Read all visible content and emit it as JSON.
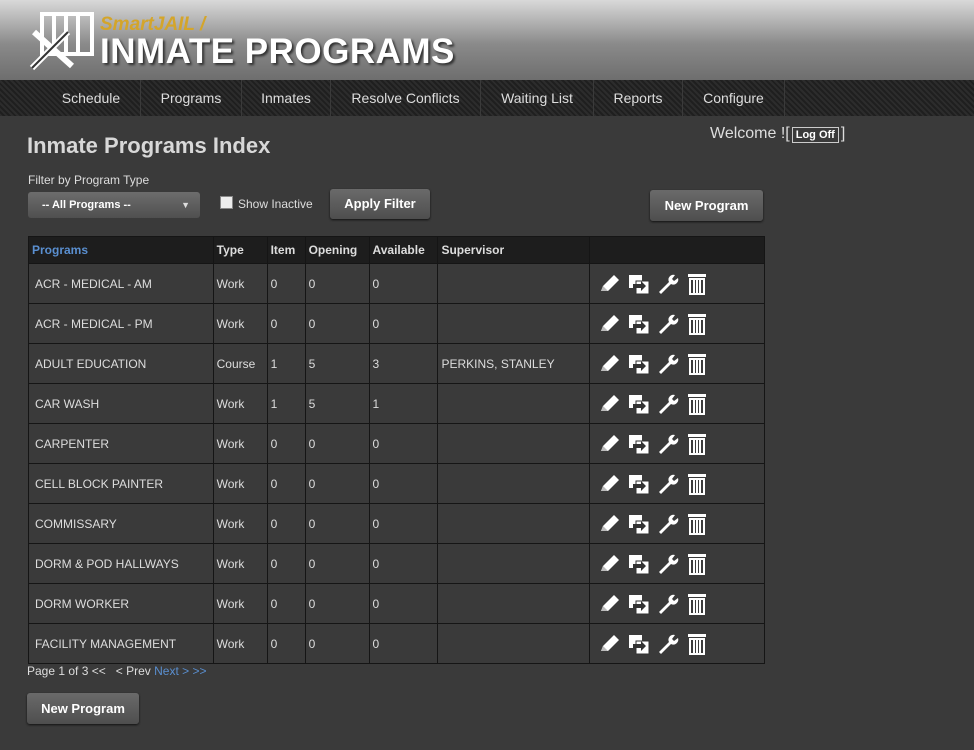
{
  "header": {
    "brand_small": "SmartJAIL /",
    "brand_big": "INMATE PROGRAMS"
  },
  "nav": [
    "Schedule",
    "Programs",
    "Inmates",
    "Resolve Conflicts",
    "Waiting List",
    "Reports",
    "Configure"
  ],
  "welcome": {
    "prefix": "Welcome ![",
    "logoff": "Log Off",
    "suffix": "]"
  },
  "page_title": "Inmate Programs Index",
  "filter": {
    "label": "Filter by Program Type",
    "selected": "-- All Programs --",
    "show_inactive_label": "Show Inactive",
    "apply_label": "Apply Filter"
  },
  "new_program_label": "New Program",
  "table": {
    "headers": [
      "Programs",
      "Type",
      "Item",
      "Opening",
      "Available",
      "Supervisor",
      ""
    ],
    "rows": [
      [
        "ACR - MEDICAL - AM",
        "Work",
        "0",
        "0",
        "0",
        ""
      ],
      [
        "ACR - MEDICAL - PM",
        "Work",
        "0",
        "0",
        "0",
        ""
      ],
      [
        "ADULT EDUCATION",
        "Course",
        "1",
        "5",
        "3",
        "PERKINS, STANLEY"
      ],
      [
        "CAR WASH",
        "Work",
        "1",
        "5",
        "1",
        ""
      ],
      [
        "CARPENTER",
        "Work",
        "0",
        "0",
        "0",
        ""
      ],
      [
        "CELL BLOCK PAINTER",
        "Work",
        "0",
        "0",
        "0",
        ""
      ],
      [
        "COMMISSARY",
        "Work",
        "0",
        "0",
        "0",
        ""
      ],
      [
        "DORM & POD HALLWAYS",
        "Work",
        "0",
        "0",
        "0",
        ""
      ],
      [
        "DORM WORKER",
        "Work",
        "0",
        "0",
        "0",
        ""
      ],
      [
        "FACILITY MANAGEMENT",
        "Work",
        "0",
        "0",
        "0",
        ""
      ]
    ],
    "row_icons": [
      "pencil-icon",
      "copy-arrow-icon",
      "wrench-icon",
      "trash-icon"
    ]
  },
  "pager": {
    "page_text": "Page 1 of 3",
    "first": "<<",
    "prev": "< Prev",
    "next": "Next >",
    "last": ">>"
  }
}
